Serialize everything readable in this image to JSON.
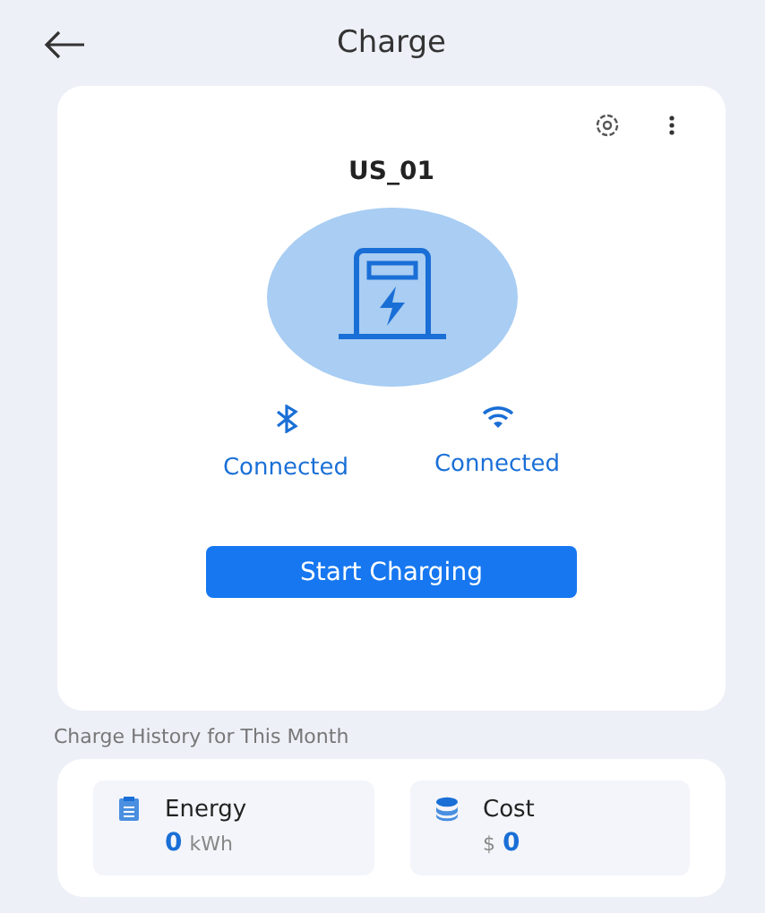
{
  "header": {
    "title": "Charge"
  },
  "charger": {
    "name": "US_01",
    "connections": [
      {
        "kind": "bluetooth",
        "label": "Connected"
      },
      {
        "kind": "wifi",
        "label": "Connected"
      }
    ],
    "button": "Start Charging"
  },
  "history": {
    "title": "Charge History for This Month",
    "stats": [
      {
        "kind": "energy",
        "label": "Energy",
        "value": "0",
        "suffix": "kWh"
      },
      {
        "kind": "cost",
        "label": "Cost",
        "prefix": "$",
        "value": "0"
      }
    ]
  }
}
